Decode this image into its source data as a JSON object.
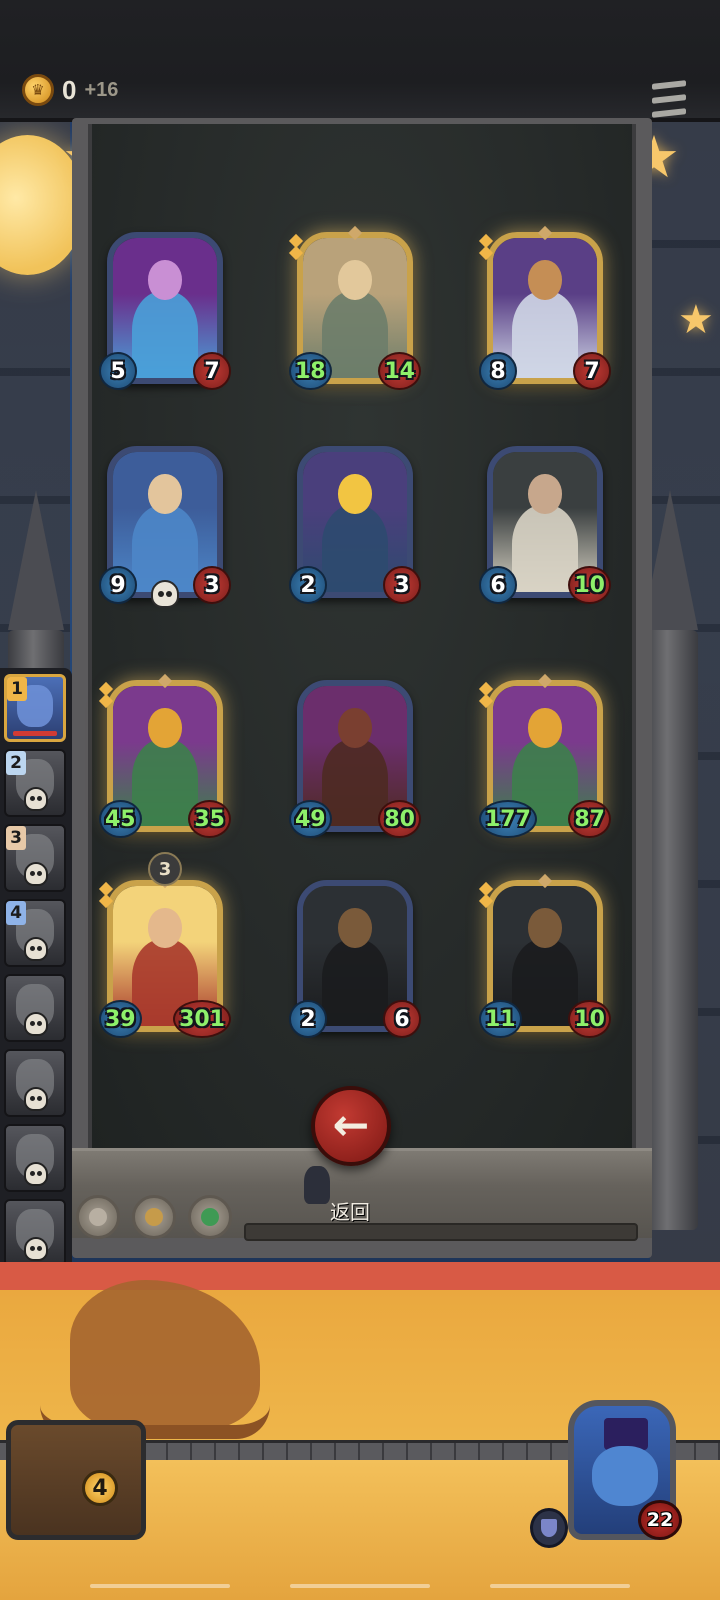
{
  "topbar": {
    "coins": "0",
    "coins_delta": "+16"
  },
  "board": {
    "cards": [
      {
        "attack": "5",
        "health": "7",
        "art": "blue-haired-elf-mage",
        "frame": "normal",
        "atk_buffed": false,
        "hp_buffed": false
      },
      {
        "attack": "18",
        "health": "14",
        "art": "helmeted-squire",
        "frame": "gold",
        "atk_buffed": true,
        "hp_buffed": true
      },
      {
        "attack": "8",
        "health": "7",
        "art": "crowned-dwarf-king",
        "frame": "gold",
        "atk_buffed": false,
        "hp_buffed": false
      },
      {
        "attack": "9",
        "health": "3",
        "art": "blue-hooded-priestess",
        "frame": "normal",
        "atk_buffed": false,
        "hp_buffed": false,
        "deathrattle": true
      },
      {
        "attack": "2",
        "health": "3",
        "art": "blond-star-boy",
        "frame": "normal",
        "atk_buffed": false,
        "hp_buffed": false
      },
      {
        "attack": "6",
        "health": "10",
        "art": "old-scheming-man",
        "frame": "normal",
        "atk_buffed": false,
        "hp_buffed": true
      },
      {
        "attack": "45",
        "health": "35",
        "art": "green-parrot",
        "frame": "gold",
        "atk_buffed": true,
        "hp_buffed": true
      },
      {
        "attack": "49",
        "health": "80",
        "art": "wild-boar",
        "frame": "normal",
        "atk_buffed": true,
        "hp_buffed": true
      },
      {
        "attack": "177",
        "health": "87",
        "art": "green-parrot",
        "frame": "gold",
        "atk_buffed": true,
        "hp_buffed": true
      },
      {
        "attack": "39",
        "health": "301",
        "art": "bald-dwarf-warrior",
        "frame": "gold",
        "atk_buffed": true,
        "hp_buffed": true,
        "level": "3"
      },
      {
        "attack": "2",
        "health": "6",
        "art": "plague-doctor",
        "frame": "normal",
        "atk_buffed": false,
        "hp_buffed": false
      },
      {
        "attack": "11",
        "health": "10",
        "art": "plague-doctor",
        "frame": "gold",
        "atk_buffed": true,
        "hp_buffed": true
      }
    ],
    "back_label": "返回"
  },
  "roster": {
    "slots": [
      {
        "rank": "1",
        "state": "active"
      },
      {
        "rank": "2",
        "state": "eliminated"
      },
      {
        "rank": "3",
        "state": "eliminated"
      },
      {
        "rank": "4",
        "state": "eliminated"
      },
      {
        "rank": "",
        "state": "eliminated"
      },
      {
        "rank": "",
        "state": "eliminated"
      },
      {
        "rank": "",
        "state": "eliminated"
      },
      {
        "rank": "",
        "state": "eliminated"
      }
    ]
  },
  "bottom": {
    "chest_count": "4",
    "hero_health": "22"
  },
  "colors": {
    "attack": "#2a6aa0",
    "health": "#b3302b",
    "buffed_text": "#8ef06a",
    "gold_frame": "#c9a24a",
    "normal_frame": "#3c4a73"
  }
}
